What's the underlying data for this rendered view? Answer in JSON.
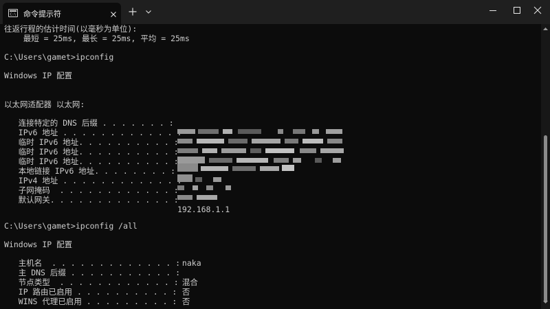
{
  "titlebar": {
    "tab_title": "命令提示符",
    "tab_icon": "cmd-console-icon",
    "close_icon": "close-icon",
    "new_tab_icon": "plus-icon",
    "dropdown_icon": "chevron-down-icon",
    "window_buttons": [
      "minimize-icon",
      "maximize-icon",
      "close-icon"
    ]
  },
  "terminal": {
    "rtt_header": "往返行程的估计时间(以毫秒为单位):",
    "rtt_stats": "    最短 = 25ms, 最长 = 25ms, 平均 = 25ms",
    "prompt1": "C:\\Users\\gamet>ipconfig",
    "header1": "Windows IP 配置",
    "adapter_header": "以太网适配器 以太网:",
    "ipconfig_rows": [
      {
        "key": "   连接特定的 DNS 后缀 . . . . . . . :",
        "value": ""
      },
      {
        "key": "   IPv6 地址 . . . . . . . . . . . . :",
        "value": ""
      },
      {
        "key": "   临时 IPv6 地址. . . . . . . . . . :",
        "value": ""
      },
      {
        "key": "   临时 IPv6 地址. . . . . . . . . . :",
        "value": ""
      },
      {
        "key": "   临时 IPv6 地址. . . . . . . . . . :",
        "value": ""
      },
      {
        "key": "   本地链接 IPv6 地址. . . . . . . . :",
        "value": ""
      },
      {
        "key": "   IPv4 地址 . . . . . . . . . . . . :",
        "value": ""
      },
      {
        "key": "   子网掩码  . . . . . . . . . . . . :",
        "value": ""
      },
      {
        "key": "   默认网关. . . . . . . . . . . . . :",
        "value": ""
      }
    ],
    "gateway_extra": "192.168.1.1",
    "prompt2": "C:\\Users\\gamet>ipconfig /all",
    "header2": "Windows IP 配置",
    "all_rows": [
      {
        "key": "   主机名  . . . . . . . . . . . . . :",
        "value": " naka"
      },
      {
        "key": "   主 DNS 后缀 . . . . . . . . . . . :",
        "value": ""
      },
      {
        "key": "   节点类型  . . . . . . . . . . . . :",
        "value": " 混合"
      },
      {
        "key": "   IP 路由已启用 . . . . . . . . . . :",
        "value": " 否"
      },
      {
        "key": "   WINS 代理已启用 . . . . . . . . . :",
        "value": " 否"
      }
    ]
  },
  "colors": {
    "background": "#0c0c0c",
    "titlebar": "#1f1f1f",
    "text": "#cccccc",
    "scroll_thumb": "#8a8a8a"
  },
  "scrollbar": {
    "up_icon": "scroll-up-arrow-icon",
    "down_icon": "scroll-down-arrow-icon"
  }
}
